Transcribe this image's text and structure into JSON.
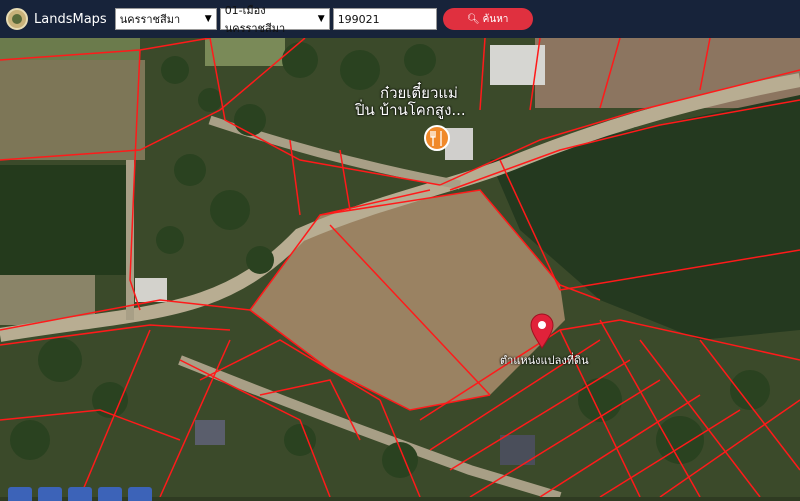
{
  "app": {
    "title": "LandsMaps"
  },
  "search": {
    "province": "นครราชสีมา",
    "district": "01-เมืองนครราชสีมา",
    "parcel_number": "199021",
    "button_label": "ค้นหา"
  },
  "map": {
    "poi_name_line1": "ก๋วยเตี๋ยวแม่",
    "poi_name_line2": "ปิ่น บ้านโคกสูง...",
    "marker_label": "ตำแหน่งแปลงที่ดิน",
    "colors": {
      "parcel_lines": "#ff1a1a",
      "marker": "#e0223a",
      "poi_icon": "#f0892a",
      "header": "#17233a",
      "search_button": "#e0303f"
    }
  }
}
